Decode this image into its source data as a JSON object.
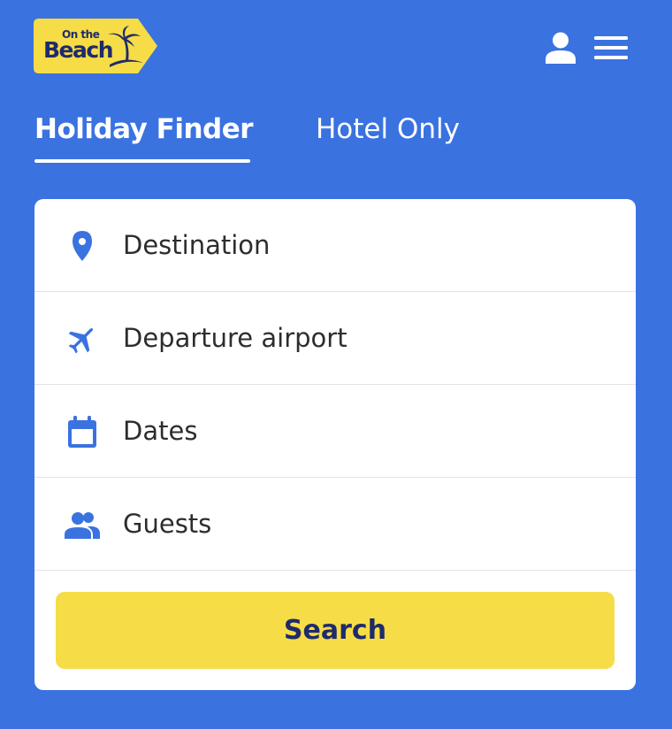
{
  "brand": {
    "logo_line1": "On the",
    "logo_line2": "Beach",
    "logo_color": "#f6dc46",
    "text_color": "#1e2b6b"
  },
  "header": {
    "account_icon": "user-icon",
    "menu_icon": "hamburger-menu-icon"
  },
  "tabs": [
    {
      "label": "Holiday Finder",
      "active": true
    },
    {
      "label": "Hotel Only",
      "active": false
    }
  ],
  "form": {
    "fields": [
      {
        "label": "Destination",
        "icon": "map-pin-icon"
      },
      {
        "label": "Departure airport",
        "icon": "airplane-icon"
      },
      {
        "label": "Dates",
        "icon": "calendar-icon"
      },
      {
        "label": "Guests",
        "icon": "people-icon"
      }
    ],
    "search_label": "Search"
  },
  "colors": {
    "background": "#3a72e0",
    "icon": "#3a72e0",
    "button": "#f6dc46",
    "button_text": "#1e2b6b"
  }
}
